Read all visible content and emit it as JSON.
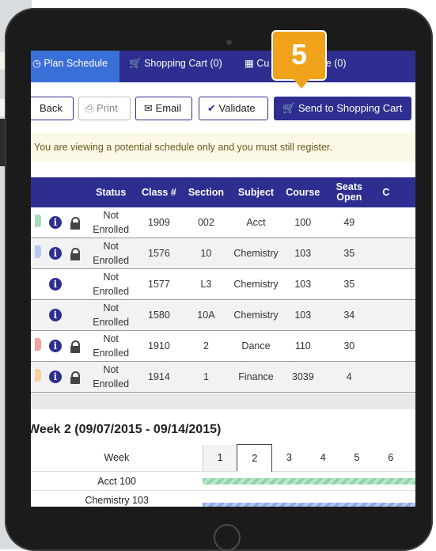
{
  "nav": {
    "tabs": [
      {
        "label": "Plan Schedule",
        "active": true
      },
      {
        "label": "Shopping Cart (0)"
      },
      {
        "label": "Cu"
      },
      {
        "label": "le (0)"
      }
    ]
  },
  "badge": {
    "number": "5",
    "color": "#f0a31a"
  },
  "toolbar": {
    "back_label": "Back",
    "print_label": "Print",
    "email_label": "Email",
    "validate_label": "Validate",
    "send_label": "Send to Shopping Cart"
  },
  "notice": {
    "text": "You are viewing a potential schedule only and you must still register."
  },
  "schedule": {
    "columns": [
      "Status",
      "Class #",
      "Section",
      "Subject",
      "Course",
      "Seats Open",
      "C"
    ],
    "rows": [
      {
        "color": "#a8dcb9",
        "locked": true,
        "status": "Not Enrolled",
        "class_no": "1909",
        "section": "002",
        "subject": "Acct",
        "course": "100",
        "seats": "49"
      },
      {
        "color": "#b7c7f0",
        "locked": true,
        "status": "Not Enrolled",
        "class_no": "1576",
        "section": "10",
        "subject": "Chemistry",
        "course": "103",
        "seats": "35"
      },
      {
        "color": "",
        "locked": false,
        "status": "Not Enrolled",
        "class_no": "1577",
        "section": "L3",
        "subject": "Chemistry",
        "course": "103",
        "seats": "35"
      },
      {
        "color": "",
        "locked": false,
        "status": "Not Enrolled",
        "class_no": "1580",
        "section": "10A",
        "subject": "Chemistry",
        "course": "103",
        "seats": "34"
      },
      {
        "color": "#f2a0a0",
        "locked": true,
        "status": "Not Enrolled",
        "class_no": "1910",
        "section": "2",
        "subject": "Dance",
        "course": "110",
        "seats": "30"
      },
      {
        "color": "#f7cfa0",
        "locked": true,
        "status": "Not Enrolled",
        "class_no": "1914",
        "section": "1",
        "subject": "Finance",
        "course": "3039",
        "seats": "4"
      }
    ]
  },
  "week": {
    "title": "Week 2 (09/07/2015 - 09/14/2015)",
    "header_label": "Week",
    "days": [
      "1",
      "2",
      "3",
      "4",
      "5",
      "6"
    ],
    "courses": [
      "Acct 100",
      "Chemistry 103"
    ]
  },
  "colors": {
    "nav": "#2d2e8f",
    "active_tab": "#3a6fd8",
    "accent": "#f0a31a"
  }
}
